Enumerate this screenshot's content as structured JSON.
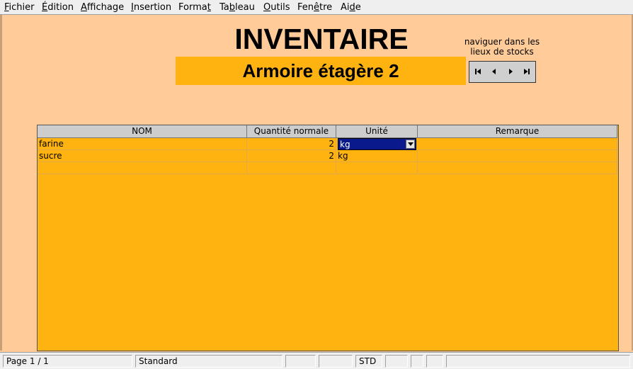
{
  "menu": [
    {
      "pre": "",
      "acc": "F",
      "post": "ichier"
    },
    {
      "pre": "",
      "acc": "É",
      "post": "dition"
    },
    {
      "pre": "",
      "acc": "A",
      "post": "ffichage"
    },
    {
      "pre": "",
      "acc": "I",
      "post": "nsertion"
    },
    {
      "pre": "Forma",
      "acc": "t",
      "post": ""
    },
    {
      "pre": "Ta",
      "acc": "b",
      "post": "leau"
    },
    {
      "pre": "",
      "acc": "O",
      "post": "utils"
    },
    {
      "pre": "Fen",
      "acc": "ê",
      "post": "tre"
    },
    {
      "pre": "Ai",
      "acc": "d",
      "post": "e"
    }
  ],
  "form": {
    "title": "INVENTAIRE",
    "location": "Armoire étagère 2",
    "nav_label_1": "naviguer dans les",
    "nav_label_2": "lieux de stocks",
    "nav_icons": [
      "first-record-icon",
      "previous-record-icon",
      "next-record-icon",
      "last-record-icon"
    ]
  },
  "grid": {
    "columns": [
      "NOM",
      "Quantité normale",
      "Unité",
      "Remarque"
    ],
    "rows": [
      {
        "nom": "farine",
        "qty": "2",
        "unit": "kg",
        "remark": ""
      },
      {
        "nom": "sucre",
        "qty": "2",
        "unit": "kg",
        "remark": ""
      }
    ]
  },
  "status": {
    "page": "Page 1 / 1",
    "style": "Standard",
    "mode": "STD"
  },
  "colors": {
    "background": "#ffcc99",
    "field": "#ffb311",
    "selection": "#0a1a8c"
  }
}
